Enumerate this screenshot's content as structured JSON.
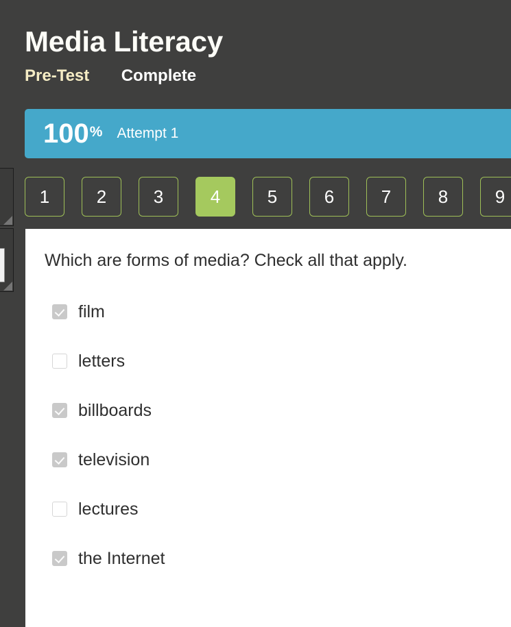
{
  "quiz": {
    "title": "Media Literacy",
    "type_label": "Pre-Test",
    "status_label": "Complete"
  },
  "score": {
    "percent": "100",
    "percent_symbol": "%",
    "attempt_label": "Attempt 1",
    "bar_color": "#45a8ca"
  },
  "question_nav": {
    "accent_color": "#9fc057",
    "active_color": "#a5c95e",
    "active_index": 3,
    "buttons": [
      {
        "label": "1",
        "active": false
      },
      {
        "label": "2",
        "active": false
      },
      {
        "label": "3",
        "active": false
      },
      {
        "label": "4",
        "active": true
      },
      {
        "label": "5",
        "active": false
      },
      {
        "label": "6",
        "active": false
      },
      {
        "label": "7",
        "active": false
      },
      {
        "label": "8",
        "active": false
      },
      {
        "label": "9",
        "active": false
      }
    ]
  },
  "question": {
    "prompt": "Which are forms of media? Check all that apply.",
    "choices": [
      {
        "label": "film",
        "checked": true
      },
      {
        "label": "letters",
        "checked": false
      },
      {
        "label": "billboards",
        "checked": true
      },
      {
        "label": "television",
        "checked": true
      },
      {
        "label": "lectures",
        "checked": false
      },
      {
        "label": "the Internet",
        "checked": true
      }
    ]
  },
  "theme": {
    "background": "#3f3f3e",
    "panel_background": "#ffffff",
    "title_color": "#fdfdf7",
    "type_label_color": "#f5ecc4"
  }
}
